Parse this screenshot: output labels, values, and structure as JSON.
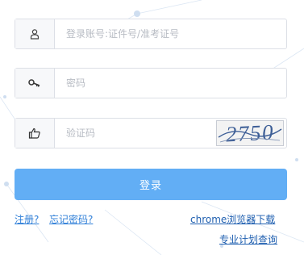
{
  "login_form": {
    "username": {
      "placeholder": "登录账号:证件号/准考证号",
      "icon": "user-icon"
    },
    "password": {
      "placeholder": "密码",
      "icon": "key-icon"
    },
    "captcha": {
      "placeholder": "验证码",
      "icon": "hand-pointer-icon",
      "image_text": "2750"
    },
    "submit_label": "登录"
  },
  "links": {
    "register": "注册?",
    "forgot_password": "忘记密码?",
    "chrome_download": "chrome浏览器下载",
    "major_plan_query": "专业计划查询"
  },
  "colors": {
    "primary_button": "#62aef5",
    "link": "#2f7fd8",
    "border": "#dcdfe6",
    "icon_cell_bg": "#f7f8fa"
  }
}
